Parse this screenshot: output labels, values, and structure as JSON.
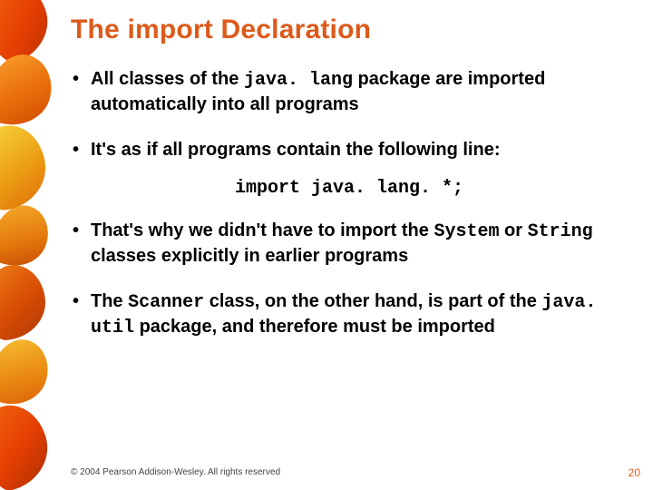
{
  "title": "The import Declaration",
  "bullets": [
    {
      "pre": "All classes of the ",
      "code1": "java. lang",
      "mid": " package are imported automatically into all programs",
      "code2": "",
      "post": ""
    },
    {
      "pre": "It's as if all programs contain the following line:",
      "code1": "",
      "mid": "",
      "code2": "",
      "post": ""
    }
  ],
  "code_line": "import java. lang. *;",
  "bullets2": [
    {
      "pre": "That's why we didn't have to import the ",
      "code1": "System",
      "mid": " or ",
      "code2": "String",
      "post": " classes explicitly in earlier programs"
    },
    {
      "pre": "The ",
      "code1": "Scanner",
      "mid": " class, on the other hand, is part of the ",
      "code2": "java. util",
      "post": " package, and therefore must be imported"
    }
  ],
  "footer": "© 2004 Pearson Addison-Wesley. All rights reserved",
  "page": "20"
}
